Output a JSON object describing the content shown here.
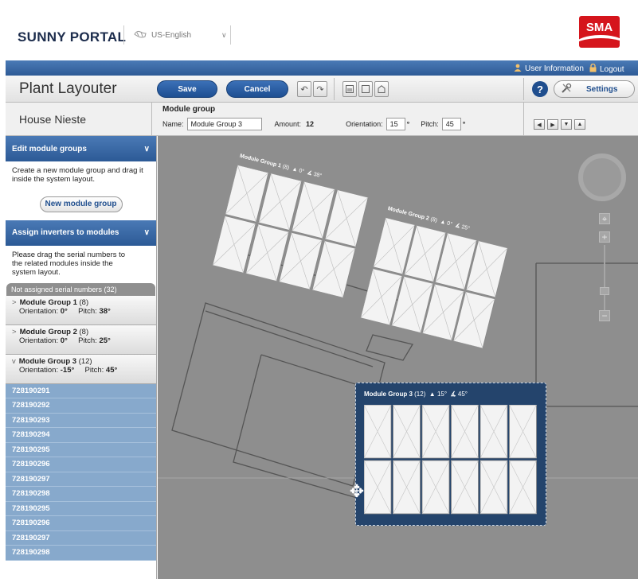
{
  "header": {
    "brand": "SUNNY PORTAL",
    "language": "US-English",
    "logo_text": "SMA"
  },
  "userbar": {
    "user_info": "User Information",
    "logout": "Logout"
  },
  "toolbar": {
    "title": "Plant Layouter",
    "save": "Save",
    "cancel": "Cancel",
    "help": "?",
    "settings": "Settings"
  },
  "props": {
    "plant_name": "House Nieste",
    "heading": "Module group",
    "name_label": "Name:",
    "name_value": "Module Group 3",
    "amount_label": "Amount:",
    "amount_value": "12",
    "orientation_label": "Orientation:",
    "orientation_value": "15",
    "pitch_label": "Pitch:",
    "pitch_value": "45",
    "degree": "°"
  },
  "sidebar": {
    "edit_header": "Edit module groups",
    "edit_text": "Create a new module group and drag it inside the system layout.",
    "new_group": "New module group",
    "assign_header": "Assign inverters to modules",
    "assign_text": "Please drag the serial numbers to the related modules inside the system layout.",
    "unassigned": "Not assigned serial numbers (32)",
    "groups": [
      {
        "name": "Module Group 1",
        "count": "(8)",
        "orientation_label": "Orientation:",
        "orientation": "0°",
        "pitch_label": "Pitch:",
        "pitch": "38°",
        "chevron": ">"
      },
      {
        "name": "Module Group 2",
        "count": "(8)",
        "orientation_label": "Orientation:",
        "orientation": "0°",
        "pitch_label": "Pitch:",
        "pitch": "25°",
        "chevron": ">"
      },
      {
        "name": "Module Group 3",
        "count": "(12)",
        "orientation_label": "Orientation:",
        "orientation": "-15°",
        "pitch_label": "Pitch:",
        "pitch": "45°",
        "chevron": "v"
      }
    ],
    "serials": [
      "728190291",
      "728190292",
      "728190293",
      "728190294",
      "728190295",
      "728190296",
      "728190297",
      "728190298",
      "728190295",
      "728190296",
      "728190297",
      "728190298"
    ]
  },
  "canvas": {
    "group1": {
      "label": "Module Group 1",
      "count": "(8)",
      "orientation": "0°",
      "pitch": "38°"
    },
    "group2": {
      "label": "Module Group 2",
      "count": "(8)",
      "orientation": "0°",
      "pitch": "25°"
    },
    "group3": {
      "label": "Module Group 3",
      "count": "(12)",
      "orientation": "15°",
      "pitch": "45°"
    }
  },
  "colors": {
    "accent_blue": "#2e5b96",
    "serial_bg": "#87a9cc",
    "brand_red": "#d5151c",
    "canvas_bg": "#8e8e8e"
  }
}
